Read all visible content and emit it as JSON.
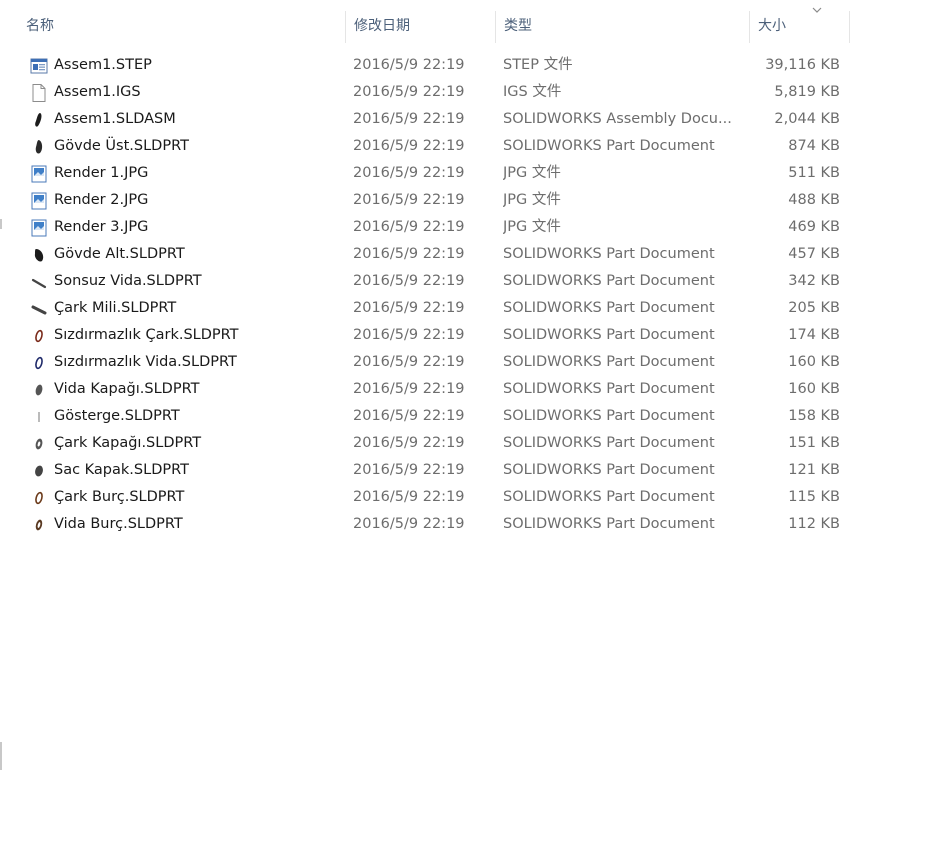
{
  "columns": {
    "name": "名称",
    "date": "修改日期",
    "type": "类型",
    "size": "大小"
  },
  "files": [
    {
      "name": "Assem1.STEP",
      "date": "2016/5/9 22:19",
      "type": "STEP 文件",
      "size": "39,116 KB",
      "icon": "step-file-icon"
    },
    {
      "name": "Assem1.IGS",
      "date": "2016/5/9 22:19",
      "type": "IGS 文件",
      "size": "5,819 KB",
      "icon": "blank-file-icon"
    },
    {
      "name": "Assem1.SLDASM",
      "date": "2016/5/9 22:19",
      "type": "SOLIDWORKS Assembly Docu...",
      "size": "2,044 KB",
      "icon": "solidworks-assembly-icon"
    },
    {
      "name": "Gövde Üst.SLDPRT",
      "date": "2016/5/9 22:19",
      "type": "SOLIDWORKS Part Document",
      "size": "874 KB",
      "icon": "solidworks-part-icon"
    },
    {
      "name": "Render 1.JPG",
      "date": "2016/5/9 22:19",
      "type": "JPG 文件",
      "size": "511 KB",
      "icon": "image-file-icon"
    },
    {
      "name": "Render 2.JPG",
      "date": "2016/5/9 22:19",
      "type": "JPG 文件",
      "size": "488 KB",
      "icon": "image-file-icon"
    },
    {
      "name": "Render 3.JPG",
      "date": "2016/5/9 22:19",
      "type": "JPG 文件",
      "size": "469 KB",
      "icon": "image-file-icon"
    },
    {
      "name": "Gövde Alt.SLDPRT",
      "date": "2016/5/9 22:19",
      "type": "SOLIDWORKS Part Document",
      "size": "457 KB",
      "icon": "solidworks-part-icon"
    },
    {
      "name": "Sonsuz Vida.SLDPRT",
      "date": "2016/5/9 22:19",
      "type": "SOLIDWORKS Part Document",
      "size": "342 KB",
      "icon": "solidworks-part-icon"
    },
    {
      "name": "Çark Mili.SLDPRT",
      "date": "2016/5/9 22:19",
      "type": "SOLIDWORKS Part Document",
      "size": "205 KB",
      "icon": "solidworks-part-icon"
    },
    {
      "name": "Sızdırmazlık Çark.SLDPRT",
      "date": "2016/5/9 22:19",
      "type": "SOLIDWORKS Part Document",
      "size": "174 KB",
      "icon": "solidworks-part-icon"
    },
    {
      "name": "Sızdırmazlık Vida.SLDPRT",
      "date": "2016/5/9 22:19",
      "type": "SOLIDWORKS Part Document",
      "size": "160 KB",
      "icon": "solidworks-part-icon"
    },
    {
      "name": "Vida Kapağı.SLDPRT",
      "date": "2016/5/9 22:19",
      "type": "SOLIDWORKS Part Document",
      "size": "160 KB",
      "icon": "solidworks-part-icon"
    },
    {
      "name": "Gösterge.SLDPRT",
      "date": "2016/5/9 22:19",
      "type": "SOLIDWORKS Part Document",
      "size": "158 KB",
      "icon": "solidworks-part-icon"
    },
    {
      "name": "Çark Kapağı.SLDPRT",
      "date": "2016/5/9 22:19",
      "type": "SOLIDWORKS Part Document",
      "size": "151 KB",
      "icon": "solidworks-part-icon"
    },
    {
      "name": "Sac Kapak.SLDPRT",
      "date": "2016/5/9 22:19",
      "type": "SOLIDWORKS Part Document",
      "size": "121 KB",
      "icon": "solidworks-part-icon"
    },
    {
      "name": "Çark Burç.SLDPRT",
      "date": "2016/5/9 22:19",
      "type": "SOLIDWORKS Part Document",
      "size": "115 KB",
      "icon": "solidworks-part-icon"
    },
    {
      "name": "Vida Burç.SLDPRT",
      "date": "2016/5/9 22:19",
      "type": "SOLIDWORKS Part Document",
      "size": "112 KB",
      "icon": "solidworks-part-icon"
    }
  ],
  "sort": {
    "column": "size",
    "direction": "descending",
    "icon": "chevron-down-icon"
  }
}
